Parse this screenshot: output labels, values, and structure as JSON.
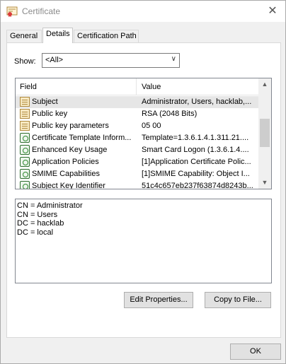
{
  "window": {
    "title": "Certificate",
    "close_glyph": "✕",
    "icon": "certificate-icon"
  },
  "tabs": [
    {
      "label": "General",
      "active": false
    },
    {
      "label": "Details",
      "active": true
    },
    {
      "label": "Certification Path",
      "active": false
    }
  ],
  "show": {
    "label": "Show:",
    "selected": "<All>"
  },
  "list": {
    "columns": {
      "field": "Field",
      "value": "Value"
    },
    "rows": [
      {
        "field": "Subject",
        "value": "Administrator, Users, hacklab,...",
        "icon": "certificate-field-icon",
        "selected": true
      },
      {
        "field": "Public key",
        "value": "RSA (2048 Bits)",
        "icon": "certificate-field-icon",
        "selected": false
      },
      {
        "field": "Public key parameters",
        "value": "05 00",
        "icon": "certificate-field-icon",
        "selected": false
      },
      {
        "field": "Certificate Template Inform...",
        "value": "Template=1.3.6.1.4.1.311.21....",
        "icon": "extension-icon",
        "selected": false
      },
      {
        "field": "Enhanced Key Usage",
        "value": "Smart Card Logon (1.3.6.1.4....",
        "icon": "extension-icon",
        "selected": false
      },
      {
        "field": "Application Policies",
        "value": "[1]Application Certificate Polic...",
        "icon": "extension-icon",
        "selected": false
      },
      {
        "field": "SMIME Capabilities",
        "value": "[1]SMIME Capability: Object I...",
        "icon": "extension-icon",
        "selected": false
      },
      {
        "field": "Subject Key Identifier",
        "value": "51c4c657eb237f63874d8243b...",
        "icon": "extension-icon",
        "selected": false
      }
    ]
  },
  "detail_lines": [
    "CN = Administrator",
    "CN = Users",
    "DC = hacklab",
    "DC = local"
  ],
  "buttons": {
    "edit_properties": "Edit Properties...",
    "copy_to_file": "Copy to File...",
    "ok": "OK"
  }
}
